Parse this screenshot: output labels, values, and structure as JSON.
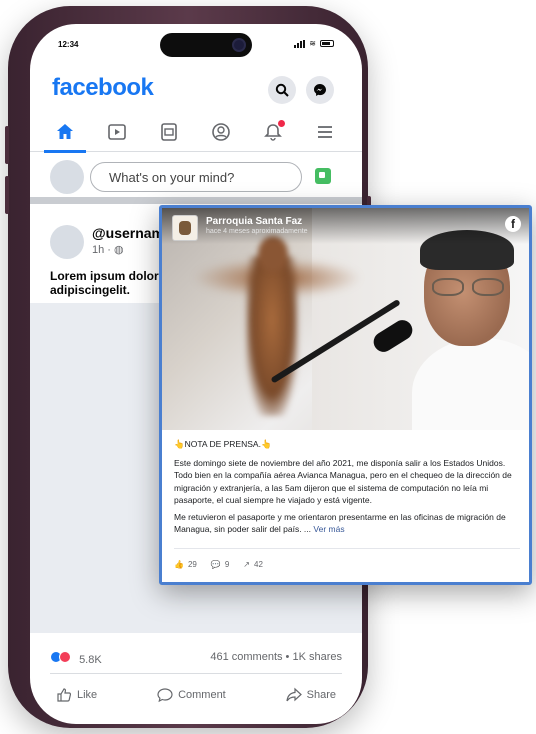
{
  "status_bar": {
    "time": "12:34"
  },
  "header": {
    "logo": "facebook"
  },
  "nav": {
    "items": [
      "home",
      "watch",
      "pages",
      "profile",
      "notifications",
      "menu"
    ]
  },
  "composer": {
    "placeholder": "What's on your mind?"
  },
  "post": {
    "username": "@username",
    "meta": "1h · ",
    "body": "Lorem ipsum dolor adipiscingelit.",
    "reaction_count": "5.8K",
    "comments_shares": "461 comments  •  1K shares",
    "actions": {
      "like": "Like",
      "comment": "Comment",
      "share": "Share"
    }
  },
  "shared_card": {
    "page_name": "Parroquia Santa Faz",
    "time": "hace 4 meses aproximadamente",
    "facebook_mark": "f",
    "headline": "👆NOTA DE PRENSA.👆",
    "paragraph_1": "Este domingo siete de noviembre del año 2021, me disponía salir a los Estados Unidos. Todo bien en la compañía aérea Avianca Managua, pero en el chequeo de la dirección de migración y extranjería, a las 5am dijeron que el sistema de computación no leía mi pasaporte, el cual siempre he viajado y está vigente.",
    "paragraph_2": "Me retuvieron el pasaporte y me orientaron presentarme en las oficinas de migración de Managua, sin poder salir del país. ...",
    "see_more": "Ver más",
    "likes": "29",
    "comments": "9",
    "shares": "42"
  },
  "colors": {
    "facebook_blue": "#1877f2",
    "phone_frame": "#4a2c3b",
    "card_border": "#4a7fd0",
    "notification_red": "#f02849"
  }
}
